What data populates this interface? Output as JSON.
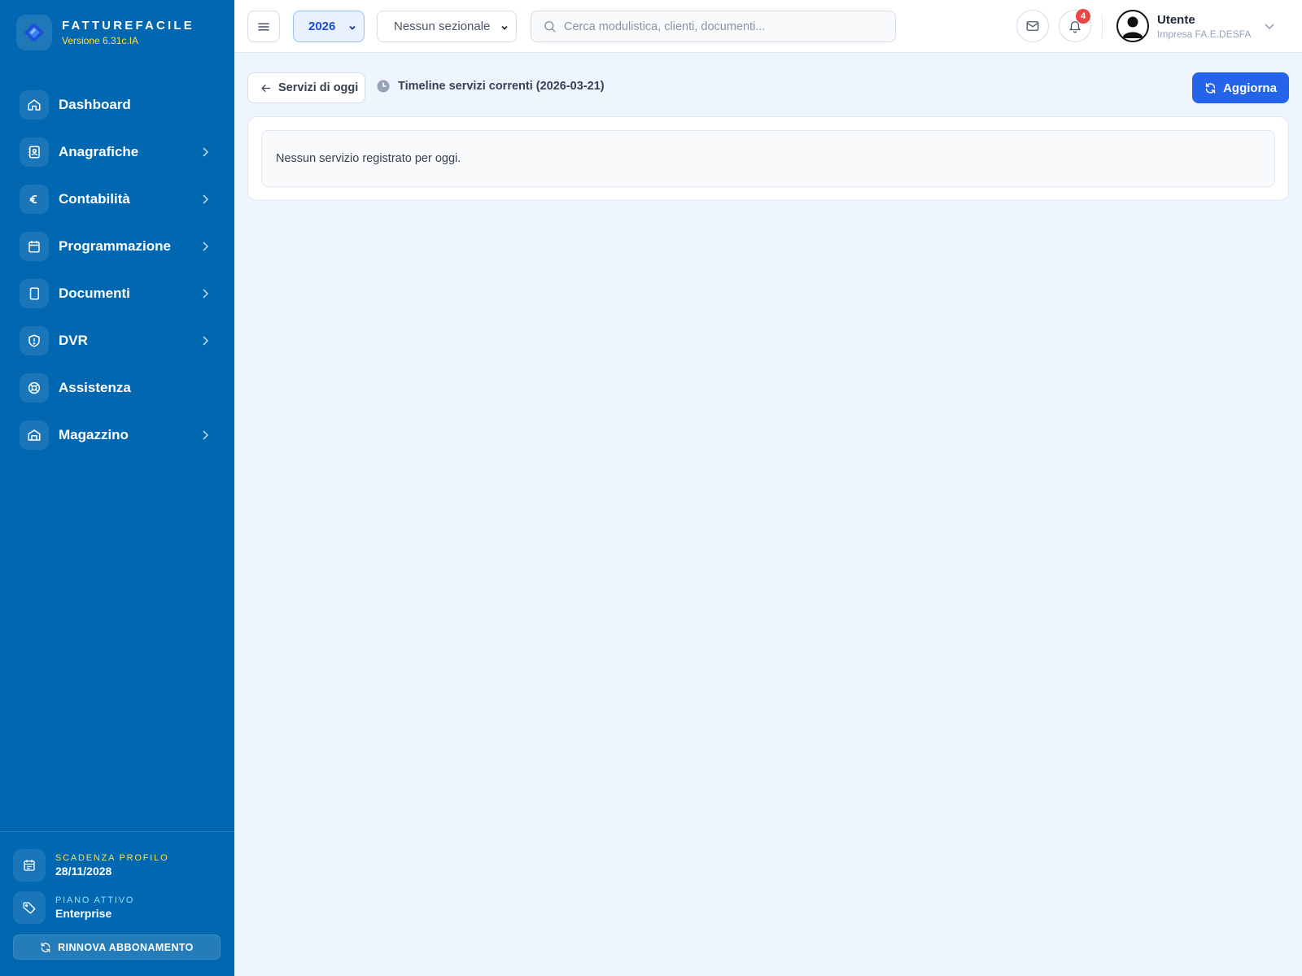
{
  "brand": {
    "name": "FATTUREFACILE",
    "version": "Versione 6.31c.IA"
  },
  "sidebar": {
    "items": [
      {
        "label": "Dashboard",
        "icon": "home-icon",
        "has_submenu": false
      },
      {
        "label": "Anagrafiche",
        "icon": "contacts-icon",
        "has_submenu": true
      },
      {
        "label": "Contabilità",
        "icon": "euro-icon",
        "has_submenu": true
      },
      {
        "label": "Programmazione",
        "icon": "calendar-icon",
        "has_submenu": true
      },
      {
        "label": "Documenti",
        "icon": "document-icon",
        "has_submenu": true
      },
      {
        "label": "DVR",
        "icon": "shield-icon",
        "has_submenu": true
      },
      {
        "label": "Assistenza",
        "icon": "lifebuoy-icon",
        "has_submenu": false
      },
      {
        "label": "Magazzino",
        "icon": "warehouse-icon",
        "has_submenu": true
      }
    ],
    "expiry": {
      "caption": "SCADENZA PROFILO",
      "value": "28/11/2028"
    },
    "plan": {
      "caption": "PIANO ATTIVO",
      "value": "Enterprise"
    },
    "renew_label": "RINNOVA ABBONAMENTO"
  },
  "header": {
    "year": "2026",
    "sezionale": "Nessun sezionale",
    "search_placeholder": "Cerca modulistica, clienti, documenti...",
    "notifications_count": "4",
    "user": {
      "name": "Utente",
      "org": "Impresa FA.E.DESFA"
    }
  },
  "main": {
    "back_label": "Servizi di oggi",
    "timeline_title": "Timeline servizi correnti (2026-03-21)",
    "refresh_label": "Aggiorna",
    "empty_message": "Nessun servizio registrato per oggi."
  },
  "colors": {
    "sidebar_bg": "#0067b0",
    "accent": "#2563eb",
    "caption_yellow": "#fde047",
    "badge_red": "#ef4444",
    "page_bg": "#eef5ff"
  }
}
